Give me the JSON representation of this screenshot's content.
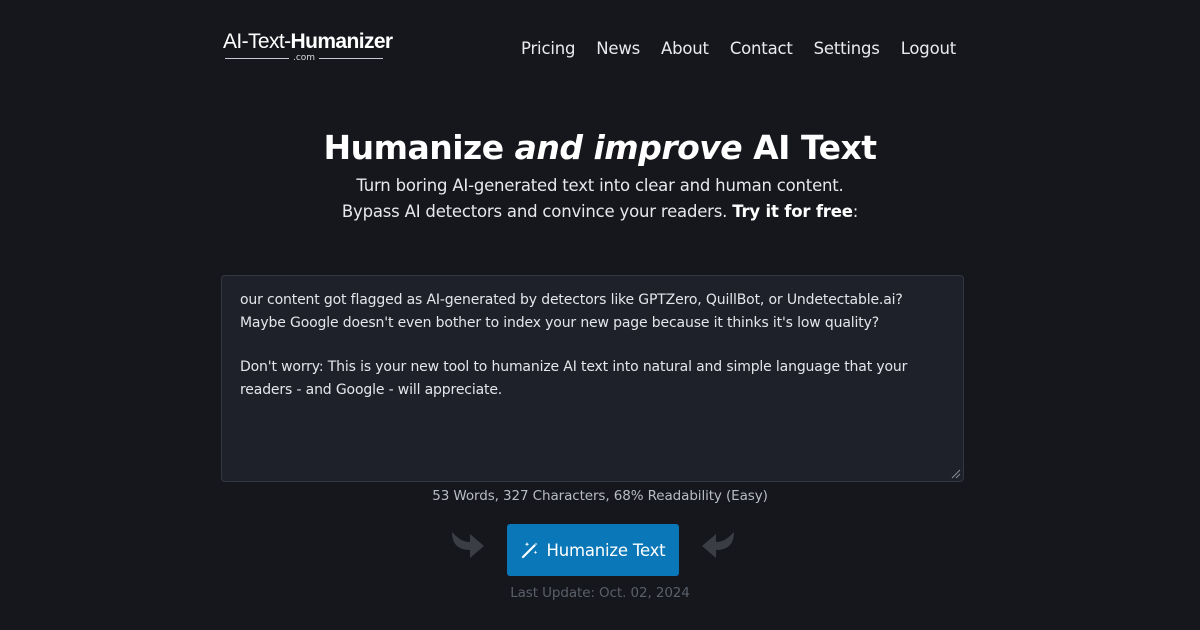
{
  "header": {
    "logo_prefix": "AI-Text-",
    "logo_bold": "Humanizer",
    "logo_suffix": ".com",
    "nav": [
      "Pricing",
      "News",
      "About",
      "Contact",
      "Settings",
      "Logout"
    ]
  },
  "hero": {
    "title_part1": "Humanize ",
    "title_emphasis": "and improve",
    "title_part2": " AI Text",
    "subtitle_line1": "Turn boring AI-generated text into clear and human content.",
    "subtitle_line2_prefix": "Bypass AI detectors and convince your readers. ",
    "subtitle_line2_bold": "Try it for free",
    "subtitle_line2_suffix": ":"
  },
  "editor": {
    "paragraph1": "our content got flagged as AI-generated by detectors like GPTZero, QuillBot, or Undetectable.ai? Maybe Google doesn't even bother to index your new page because it thinks it's low quality?",
    "paragraph2": "Don't worry: This is your new tool to humanize AI text into natural and simple language that your readers - and Google - will appreciate."
  },
  "stats": "53 Words, 327 Characters, 68% Readability (Easy)",
  "action": {
    "button_label": "Humanize Text",
    "button_icon": "magic-wand-icon",
    "last_update": "Last Update: Oct. 02, 2024"
  },
  "colors": {
    "background": "#15171c",
    "editor_bg": "#1e212a",
    "button": "#0a78b8",
    "arrow": "#3a3d44"
  }
}
